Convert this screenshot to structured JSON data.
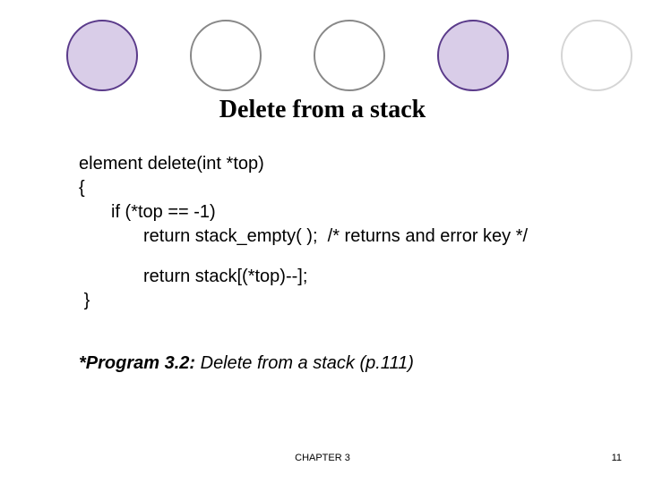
{
  "title": "Delete from a stack",
  "code": {
    "l1": "element delete(int *top)",
    "l2": "{",
    "l3": "if (*top == -1)",
    "l4_a": "return stack_empty( );",
    "l4_b": "/* returns and error key */",
    "l5": "return stack[(*top)--];",
    "l6": "}"
  },
  "caption_bold": "*Program 3.2:",
  "caption_rest": " Delete from a stack (p.111)",
  "footer_center": "CHAPTER 3",
  "footer_right": "11"
}
